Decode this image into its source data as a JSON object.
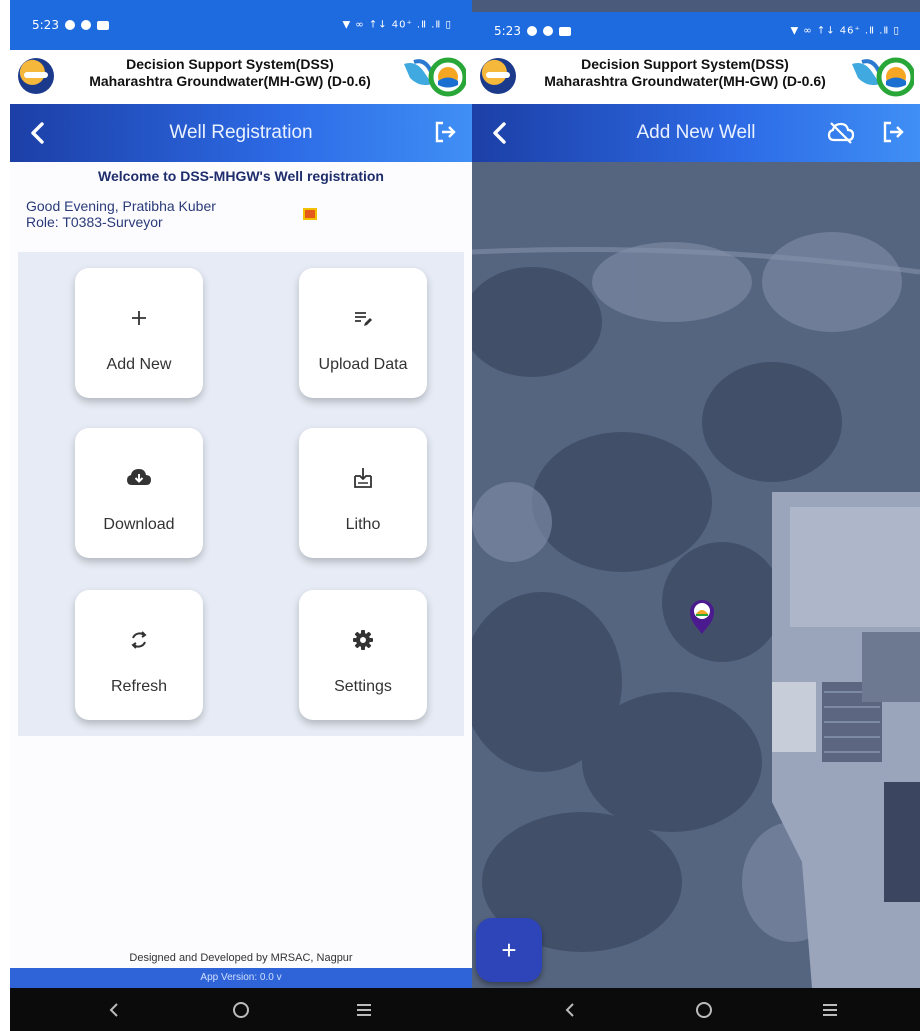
{
  "left": {
    "status": {
      "time": "5:23",
      "right": "▼ ∞ ↑↓ 40⁺ .Ⅱ .Ⅱ ▯"
    },
    "app_title_line1": "Decision Support System(DSS)",
    "app_title_line2": "Maharashtra Groundwater(MH-GW) (D-0.6)",
    "nav_title": "Well Registration",
    "welcome": "Welcome to DSS-MHGW's Well registration",
    "greeting": "Good Evening, Pratibha Kuber",
    "role": "Role: T0383-Surveyor",
    "tiles": [
      {
        "label": "Add New",
        "icon": "plus-icon"
      },
      {
        "label": "Upload Data",
        "icon": "edit-list-icon"
      },
      {
        "label": "Download",
        "icon": "cloud-download-icon"
      },
      {
        "label": "Litho",
        "icon": "litho-icon"
      },
      {
        "label": "Refresh",
        "icon": "refresh-icon"
      },
      {
        "label": "Settings",
        "icon": "gear-icon"
      }
    ],
    "footer": "Designed and Developed by MRSAC, Nagpur",
    "version": "App Version: 0.0 v"
  },
  "right": {
    "status": {
      "time": "5:23",
      "right": "▼ ∞ ↑↓ 46⁺ .Ⅱ .Ⅱ ▯"
    },
    "app_title_line1": "Decision Support System(DSS)",
    "app_title_line2": "Maharashtra Groundwater(MH-GW) (D-0.6)",
    "nav_title": "Add New Well",
    "fab_label": "+"
  },
  "colors": {
    "accent": "#2d6be6",
    "status_bar": "#1e6be0",
    "tile_bg": "#ffffff",
    "grid_bg": "#e6ebf5",
    "fab": "#2d45b8",
    "marker": "#4b1a8f"
  }
}
